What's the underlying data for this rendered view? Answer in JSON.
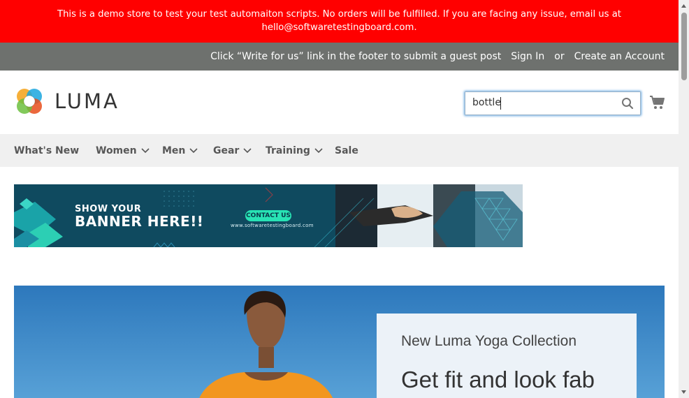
{
  "notice": {
    "line1": "This is a demo store to test your test automaiton scripts. No orders will be fulfilled. If you are facing any issue, email us at",
    "line2": "hello@softwaretestingboard.com."
  },
  "header_panel": {
    "write_for_us": "Click “Write for us” link in the footer to submit a guest post",
    "sign_in": "Sign In",
    "or": "or",
    "create_account": "Create an Account"
  },
  "logo": {
    "text": "LUMA"
  },
  "search": {
    "value": "bottle",
    "icon": "search-icon"
  },
  "cart": {
    "icon": "cart-icon"
  },
  "nav": {
    "items": [
      {
        "label": "What's New",
        "dropdown": false
      },
      {
        "label": "Women",
        "dropdown": true
      },
      {
        "label": "Men",
        "dropdown": true
      },
      {
        "label": "Gear",
        "dropdown": true
      },
      {
        "label": "Training",
        "dropdown": true
      },
      {
        "label": "Sale",
        "dropdown": false
      }
    ]
  },
  "banner": {
    "line1": "SHOW YOUR",
    "line2": "BANNER HERE!!",
    "contact": "CONTACT US",
    "url": "www.softwaretestingboard.com"
  },
  "hero": {
    "subtitle": "New Luma Yoga Collection",
    "title": "Get fit and look fab"
  },
  "colors": {
    "notice_bg": "#ff0000",
    "panel_bg": "#6e716e",
    "nav_bg": "#f0f0f0",
    "search_focus": "#68a8e0"
  }
}
